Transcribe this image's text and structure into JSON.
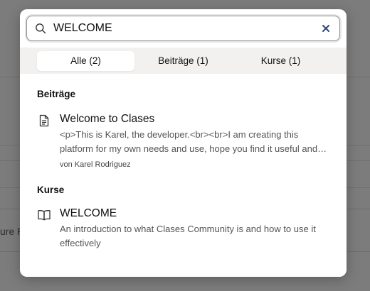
{
  "background": {
    "partial_text": "ure P"
  },
  "search": {
    "value": "WELCOME",
    "icon": "search-icon",
    "clear_icon": "close-icon"
  },
  "tabs": [
    {
      "label": "Alle (2)",
      "active": true
    },
    {
      "label": "Beiträge (1)",
      "active": false
    },
    {
      "label": "Kurse (1)",
      "active": false
    }
  ],
  "sections": {
    "posts": {
      "title": "Beiträge",
      "item": {
        "icon": "document-icon",
        "title": "Welcome to Clases",
        "snippet": "<p>This is Karel, the developer.<br><br>I am creating this platform for my own needs and use, hope you find it useful and enjoy it.",
        "author": "von Karel Rodriguez"
      }
    },
    "courses": {
      "title": "Kurse",
      "item": {
        "icon": "book-icon",
        "title": "WELCOME",
        "snippet": "An introduction to what Clases Community is and how to use it effectively"
      }
    }
  },
  "colors": {
    "overlay": "#7c7c7c",
    "tabs_bg": "#f2f1ef",
    "clear_icon": "#2c4a7a"
  }
}
